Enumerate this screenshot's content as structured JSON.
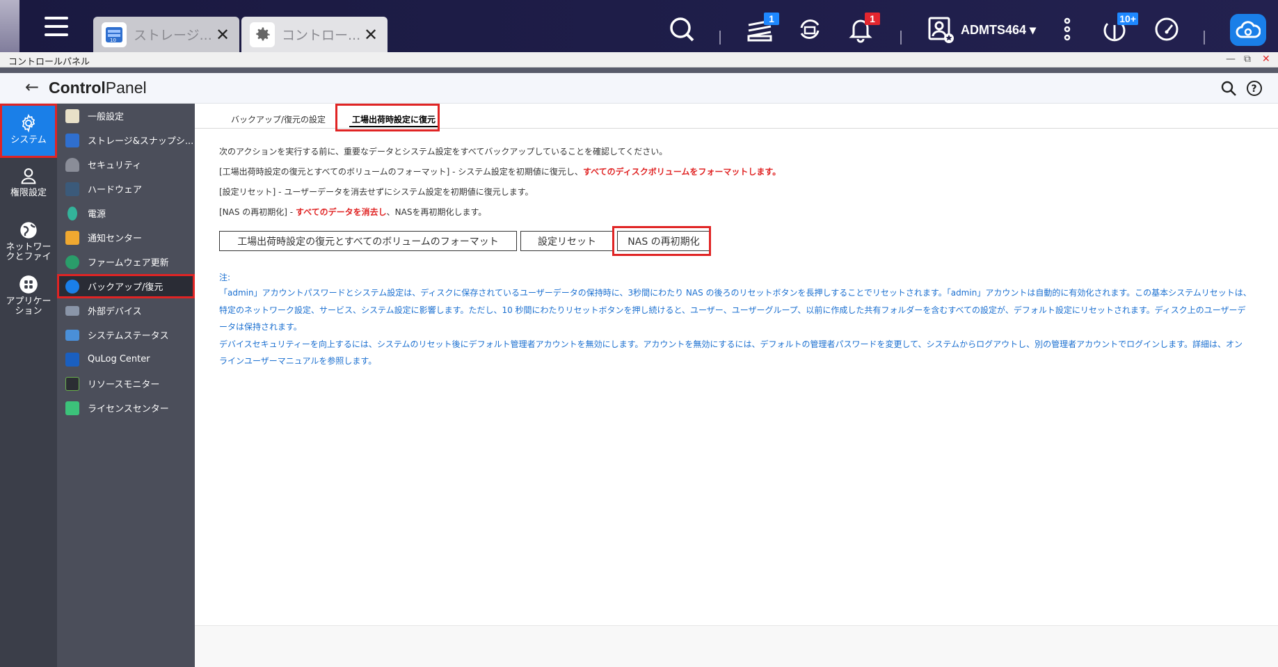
{
  "taskbar": {
    "tabs": [
      {
        "label": "ストレージ..."
      },
      {
        "label": "コントロー..."
      }
    ],
    "badges": {
      "tasks": "1",
      "notifications": "1",
      "updates": "10+"
    },
    "user_name": "ADMTS464"
  },
  "window": {
    "title": "コントロールパネル"
  },
  "header": {
    "title_bold": "Control",
    "title_light": "Panel"
  },
  "rail": {
    "items": [
      {
        "label": "システム"
      },
      {
        "label": "権限設定"
      },
      {
        "label": "ネットワークとファイ"
      },
      {
        "label": "アプリケーション"
      }
    ]
  },
  "subnav": {
    "items": [
      {
        "label": "一般設定"
      },
      {
        "label": "ストレージ&スナップシ..."
      },
      {
        "label": "セキュリティ"
      },
      {
        "label": "ハードウェア"
      },
      {
        "label": "電源"
      },
      {
        "label": "通知センター"
      },
      {
        "label": "ファームウェア更新"
      },
      {
        "label": "バックアップ/復元"
      },
      {
        "label": "外部デバイス"
      },
      {
        "label": "システムステータス"
      },
      {
        "label": "QuLog Center"
      },
      {
        "label": "リソースモニター"
      },
      {
        "label": "ライセンスセンター"
      }
    ]
  },
  "content": {
    "tabs": [
      {
        "label": "バックアップ/復元の設定"
      },
      {
        "label": "工場出荷時設定に復元"
      }
    ],
    "intro": "次のアクションを実行する前に、重要なデータとシステム設定をすべてバックアップしていることを確認してください。",
    "line1_prefix": "[工場出荷時設定の復元とすべてのボリュームのフォーマット] - システム設定を初期値に復元し、",
    "line1_red": "すべてのディスクボリュームをフォーマットします。",
    "line2": "[設定リセット] - ユーザーデータを消去せずにシステム設定を初期値に復元します。",
    "line3_prefix": "[NAS の再初期化] - ",
    "line3_red": "すべてのデータを消去し",
    "line3_suffix": "、NASを再初期化します。",
    "buttons": {
      "factory_reset": "工場出荷時設定の復元とすべてのボリュームのフォーマット",
      "settings_reset": "設定リセット",
      "reinit": "NAS の再初期化"
    },
    "note_label": "注:",
    "note_lines": [
      "「admin」アカウントパスワードとシステム設定は、ディスクに保存されているユーザーデータの保持時に、3秒間にわたり NAS の後ろのリセットボタンを長押しすることでリセットされます。「admin」アカウントは自動的に有効化されます。この基本システムリセットは、",
      "特定のネットワーク設定、サービス、システム設定に影響します。ただし、10 秒間にわたりリセットボタンを押し続けると、ユーザー、ユーザーグループ、以前に作成した共有フォルダーを含むすべての設定が、デフォルト設定にリセットされます。ディスク上のユーザーデ",
      "ータは保持されます。",
      "デバイスセキュリティーを向上するには、システムのリセット後にデフォルト管理者アカウントを無効にします。アカウントを無効にするには、デフォルトの管理者パスワードを変更して、システムからログアウトし、別の管理者アカウントでログインします。詳細は、オン",
      "ラインユーザーマニュアルを参照します。"
    ]
  }
}
